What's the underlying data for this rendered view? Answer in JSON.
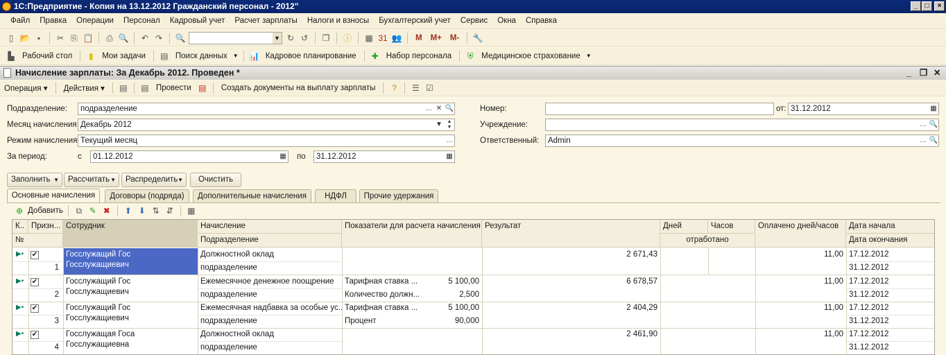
{
  "app": {
    "title": "1С:Предприятие - Копия на 13.12.2012 Гражданский персонал - 2012\""
  },
  "menu": [
    "Файл",
    "Правка",
    "Операции",
    "Персонал",
    "Кадровый учет",
    "Расчет зарплаты",
    "Налоги и взносы",
    "Бухгалтерский учет",
    "Сервис",
    "Окна",
    "Справка"
  ],
  "toolbar2": [
    "Рабочий стол",
    "Мои задачи",
    "Поиск данных",
    "Кадровое планирование",
    "Набор персонала",
    "Медицинское страхование"
  ],
  "toolbar_m": [
    "M",
    "M+",
    "M-"
  ],
  "doc": {
    "title": "Начисление зарплаты: За Декабрь 2012. Проведен *",
    "toolbar": {
      "operation": "Операция",
      "actions": "Действия",
      "post": "Провести",
      "create": "Создать документы на выплату зарплаты"
    },
    "fields": {
      "dept_label": "Подразделение:",
      "dept": "подразделение",
      "month_label": "Месяц начисления:",
      "month": "Декабрь 2012",
      "mode_label": "Режим начисления:",
      "mode": "Текущий месяц",
      "period_label": "За период:",
      "from_label": "с",
      "from": "01.12.2012",
      "to_label": "по",
      "to": "31.12.2012",
      "num_label": "Номер:",
      "num": "",
      "date_label": "от:",
      "date": "31.12.2012",
      "inst_label": "Учреждение:",
      "inst": "",
      "resp_label": "Ответственный:",
      "resp": "Admin"
    },
    "buttons": {
      "fill": "Заполнить",
      "calc": "Рассчитать",
      "distribute": "Распределить",
      "clear": "Очистить"
    },
    "tabs": [
      "Основные начисления",
      "Договоры (подряда)",
      "Дополнительные начисления",
      "НДФЛ",
      "Прочие удержания"
    ],
    "add": "Добавить"
  },
  "grid": {
    "headers": {
      "k": "К..",
      "sign": "Призн...",
      "num": "№",
      "employee": "Сотрудник",
      "accrual": "Начисление",
      "dept": "Подразделение",
      "indicators": "Показатели для расчета начисления",
      "result": "Результат",
      "days": "Дней",
      "hours": "Часов",
      "worked": "отработано",
      "paid": "Оплачено дней/часов",
      "start": "Дата начала",
      "end": "Дата окончания"
    },
    "rows": [
      {
        "n": "1",
        "employee": "Госслужащий Гос Госслужащиевич",
        "accrual": "Должностной оклад",
        "dept": "подразделение",
        "ind": [],
        "result": "2 671,43",
        "paid": "11,00",
        "start": "17.12.2012",
        "end": "31.12.2012"
      },
      {
        "n": "2",
        "employee": "Госслужащий Гос Госслужащиевич",
        "accrual": "Ежемесячное денежное поощрение",
        "dept": "подразделение",
        "ind": [
          [
            "Тарифная ставка ...",
            "5 100,00"
          ],
          [
            "Количество должн...",
            "2,500"
          ]
        ],
        "result": "6 678,57",
        "paid": "11,00",
        "start": "17.12.2012",
        "end": "31.12.2012"
      },
      {
        "n": "3",
        "employee": "Госслужащий Гос Госслужащиевич",
        "accrual": "Ежемесячная надбавка за особые ус...",
        "dept": "подразделение",
        "ind": [
          [
            "Тарифная ставка ...",
            "5 100,00"
          ],
          [
            "Процент",
            "90,000"
          ]
        ],
        "result": "2 404,29",
        "paid": "11,00",
        "start": "17.12.2012",
        "end": "31.12.2012"
      },
      {
        "n": "4",
        "employee": "Госслужащая Госа Госслужащиевна",
        "accrual": "Должностной оклад",
        "dept": "подразделение",
        "ind": [],
        "result": "2 461,90",
        "paid": "11,00",
        "start": "17.12.2012",
        "end": "31.12.2012"
      }
    ]
  },
  "colors": {
    "title": "#0a246a",
    "selected": "#4b68c4",
    "bg": "#fbf6e3"
  }
}
